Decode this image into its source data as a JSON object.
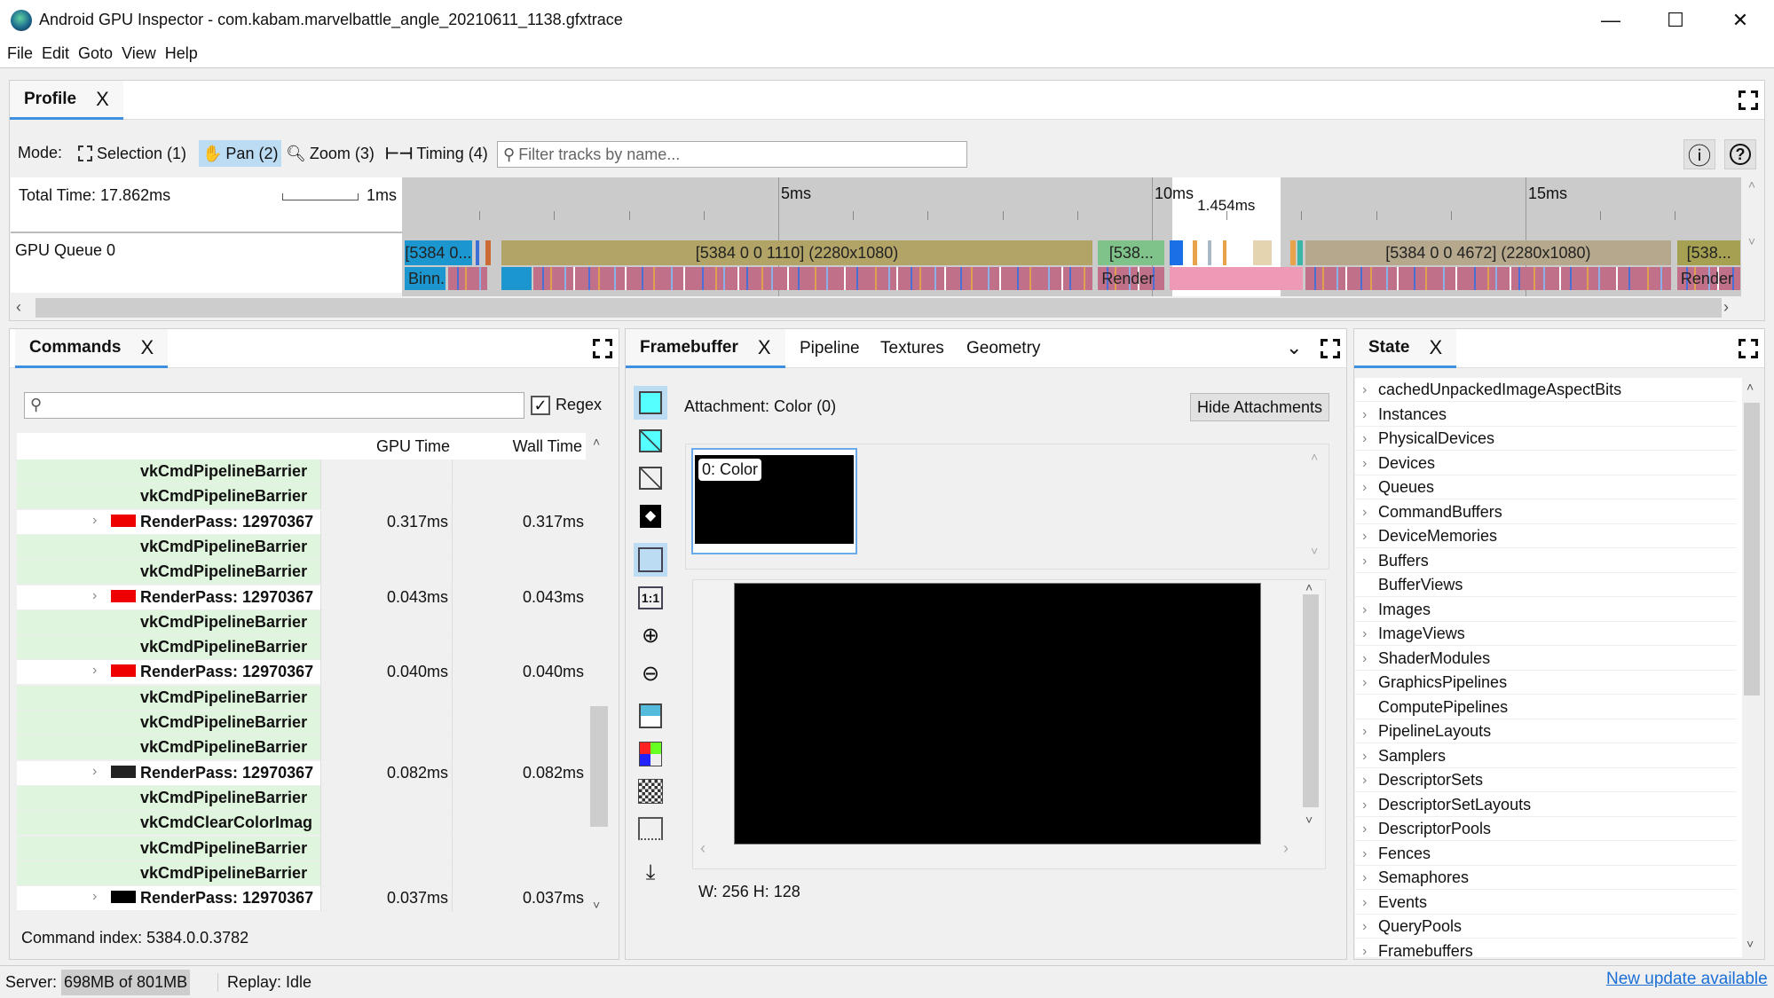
{
  "window": {
    "title": "Android GPU Inspector - com.kabam.marvelbattle_angle_20210611_1138.gfxtrace",
    "minimize": "—",
    "maximize": "☐",
    "close": "✕"
  },
  "menu": [
    "File",
    "Edit",
    "Goto",
    "View",
    "Help"
  ],
  "profile": {
    "tab": "Profile",
    "close": "X",
    "mode_label": "Mode:",
    "modes": [
      {
        "label": "Selection (1)",
        "icon": "selection-icon"
      },
      {
        "label": "Pan (2)",
        "icon": "hand-icon",
        "selected": true
      },
      {
        "label": "Zoom (3)",
        "icon": "zoom-icon"
      },
      {
        "label": "Timing (4)",
        "icon": "timing-icon"
      }
    ],
    "filter_placeholder": "Filter tracks by name...",
    "total_time": "Total Time: 17.862ms",
    "scale_label": "1ms",
    "ticks": [
      "5ms",
      "10ms",
      "15ms"
    ],
    "selection_label": "1.454ms",
    "selection_ms": [
      10.27,
      11.72
    ],
    "track": "GPU Queue 0",
    "top_segments": [
      {
        "start": 0,
        "end": 0.9,
        "label": "[5384 0...",
        "color": "#1b96ce"
      },
      {
        "start": 0.95,
        "end": 1.0,
        "label": "",
        "color": "#3b6fd6"
      },
      {
        "start": 1.08,
        "end": 1.15,
        "label": "",
        "color": "#cc6a33"
      },
      {
        "start": 1.3,
        "end": 9.2,
        "label": "[5384 0 0 1110] (2280x1080)",
        "color": "#b2a467"
      },
      {
        "start": 9.28,
        "end": 10.17,
        "label": "[538...",
        "color": "#7fc28a"
      },
      {
        "start": 10.24,
        "end": 10.42,
        "label": "",
        "color": "#1a6fe6"
      },
      {
        "start": 10.55,
        "end": 10.6,
        "label": "",
        "color": "#e7a24a"
      },
      {
        "start": 10.75,
        "end": 10.8,
        "label": "",
        "color": "#a8b8c4"
      },
      {
        "start": 10.95,
        "end": 11.0,
        "label": "",
        "color": "#e7a24a"
      },
      {
        "start": 11.35,
        "end": 11.6,
        "label": "",
        "color": "#e4d4b0"
      },
      {
        "start": 11.85,
        "end": 11.92,
        "label": "",
        "color": "#e7a24a"
      },
      {
        "start": 11.95,
        "end": 12.02,
        "label": "",
        "color": "#3bb5a5"
      },
      {
        "start": 12.05,
        "end": 16.95,
        "label": "[5384 0 0 4672] (2280x1080)",
        "color": "#b6a88c"
      },
      {
        "start": 17.03,
        "end": 17.88,
        "label": "[538...",
        "color": "#a6a052"
      }
    ],
    "bottom_segments": [
      {
        "start": 0,
        "end": 0.55,
        "label": "Binn...",
        "color": "#1b96ce"
      },
      {
        "start": 0.58,
        "end": 1.1,
        "label": "",
        "color": "#c07088"
      },
      {
        "start": 1.3,
        "end": 1.7,
        "label": "",
        "color": "#1b96ce"
      },
      {
        "start": 1.72,
        "end": 9.2,
        "label": "",
        "color": "#c07088"
      },
      {
        "start": 9.28,
        "end": 10.17,
        "label": "Render",
        "color": "#c07088"
      },
      {
        "start": 10.24,
        "end": 12.02,
        "label": "",
        "color": "#ee9ab6"
      },
      {
        "start": 12.05,
        "end": 16.95,
        "label": "",
        "color": "#c07088"
      },
      {
        "start": 17.03,
        "end": 17.88,
        "label": "Render",
        "color": "#c07088"
      }
    ],
    "info_icon": "ⓘ",
    "help_icon": "?"
  },
  "commands": {
    "tab": "Commands",
    "close": "X",
    "regex": "Regex",
    "regex_checked": true,
    "columns": [
      "",
      "GPU Time",
      "Wall Time"
    ],
    "rows": [
      {
        "name": "vkCmdPipelineBarrier",
        "type": "cmd"
      },
      {
        "name": "vkCmdPipelineBarrier",
        "type": "cmd"
      },
      {
        "name": "RenderPass: 12970367",
        "type": "rp",
        "swatch": "#ee0000",
        "gpu": "0.317ms",
        "wall": "0.317ms"
      },
      {
        "name": "vkCmdPipelineBarrier",
        "type": "cmd"
      },
      {
        "name": "vkCmdPipelineBarrier",
        "type": "cmd"
      },
      {
        "name": "RenderPass: 12970367",
        "type": "rp",
        "swatch": "#ee0000",
        "gpu": "0.043ms",
        "wall": "0.043ms"
      },
      {
        "name": "vkCmdPipelineBarrier",
        "type": "cmd"
      },
      {
        "name": "vkCmdPipelineBarrier",
        "type": "cmd"
      },
      {
        "name": "RenderPass: 12970367",
        "type": "rp",
        "swatch": "#ee0000",
        "gpu": "0.040ms",
        "wall": "0.040ms"
      },
      {
        "name": "vkCmdPipelineBarrier",
        "type": "cmd"
      },
      {
        "name": "vkCmdPipelineBarrier",
        "type": "cmd"
      },
      {
        "name": "vkCmdPipelineBarrier",
        "type": "cmd"
      },
      {
        "name": "RenderPass: 12970367",
        "type": "rp",
        "swatch": "#222222",
        "gpu": "0.082ms",
        "wall": "0.082ms"
      },
      {
        "name": "vkCmdPipelineBarrier",
        "type": "cmd"
      },
      {
        "name": "vkCmdClearColorImag",
        "type": "cmd"
      },
      {
        "name": "vkCmdPipelineBarrier",
        "type": "cmd"
      },
      {
        "name": "vkCmdPipelineBarrier",
        "type": "cmd"
      },
      {
        "name": "RenderPass: 12970367",
        "type": "rp",
        "swatch": "#000000",
        "gpu": "0.037ms",
        "wall": "0.037ms"
      }
    ],
    "command_index": "Command index: 5384.0.0.3782"
  },
  "framebuffer": {
    "tabs": [
      "Framebuffer",
      "Pipeline",
      "Textures",
      "Geometry"
    ],
    "close": "X",
    "attachment": "Attachment: Color (0)",
    "hide_button": "Hide Attachments",
    "thumb_label": "0: Color",
    "size": "W: 256 H: 128",
    "tools": [
      "color-attachment-icon",
      "wireframe-overlay-icon",
      "wireframe-icon",
      "depth-icon",
      "fit-to-window-icon",
      "original-size-icon",
      "zoom-in-icon",
      "zoom-out-icon",
      "histogram-icon",
      "color-channels-icon",
      "checkerboard-icon",
      "flip-icon",
      "download-icon"
    ]
  },
  "state": {
    "tab": "State",
    "close": "X",
    "items": [
      {
        "label": "cachedUnpackedImageAspectBits",
        "expandable": true
      },
      {
        "label": "Instances",
        "expandable": true
      },
      {
        "label": "PhysicalDevices",
        "expandable": true
      },
      {
        "label": "Devices",
        "expandable": true
      },
      {
        "label": "Queues",
        "expandable": true
      },
      {
        "label": "CommandBuffers",
        "expandable": true
      },
      {
        "label": "DeviceMemories",
        "expandable": true
      },
      {
        "label": "Buffers",
        "expandable": true
      },
      {
        "label": "BufferViews",
        "expandable": false
      },
      {
        "label": "Images",
        "expandable": true
      },
      {
        "label": "ImageViews",
        "expandable": true
      },
      {
        "label": "ShaderModules",
        "expandable": true
      },
      {
        "label": "GraphicsPipelines",
        "expandable": true
      },
      {
        "label": "ComputePipelines",
        "expandable": false
      },
      {
        "label": "PipelineLayouts",
        "expandable": true
      },
      {
        "label": "Samplers",
        "expandable": true
      },
      {
        "label": "DescriptorSets",
        "expandable": true
      },
      {
        "label": "DescriptorSetLayouts",
        "expandable": true
      },
      {
        "label": "DescriptorPools",
        "expandable": true
      },
      {
        "label": "Fences",
        "expandable": true
      },
      {
        "label": "Semaphores",
        "expandable": true
      },
      {
        "label": "Events",
        "expandable": true
      },
      {
        "label": "QueryPools",
        "expandable": true
      },
      {
        "label": "Framebuffers",
        "expandable": true
      }
    ]
  },
  "status": {
    "server_label": "Server:",
    "server_value": "698MB of 801MB",
    "replay": "Replay: Idle",
    "update_link": "New update available"
  }
}
